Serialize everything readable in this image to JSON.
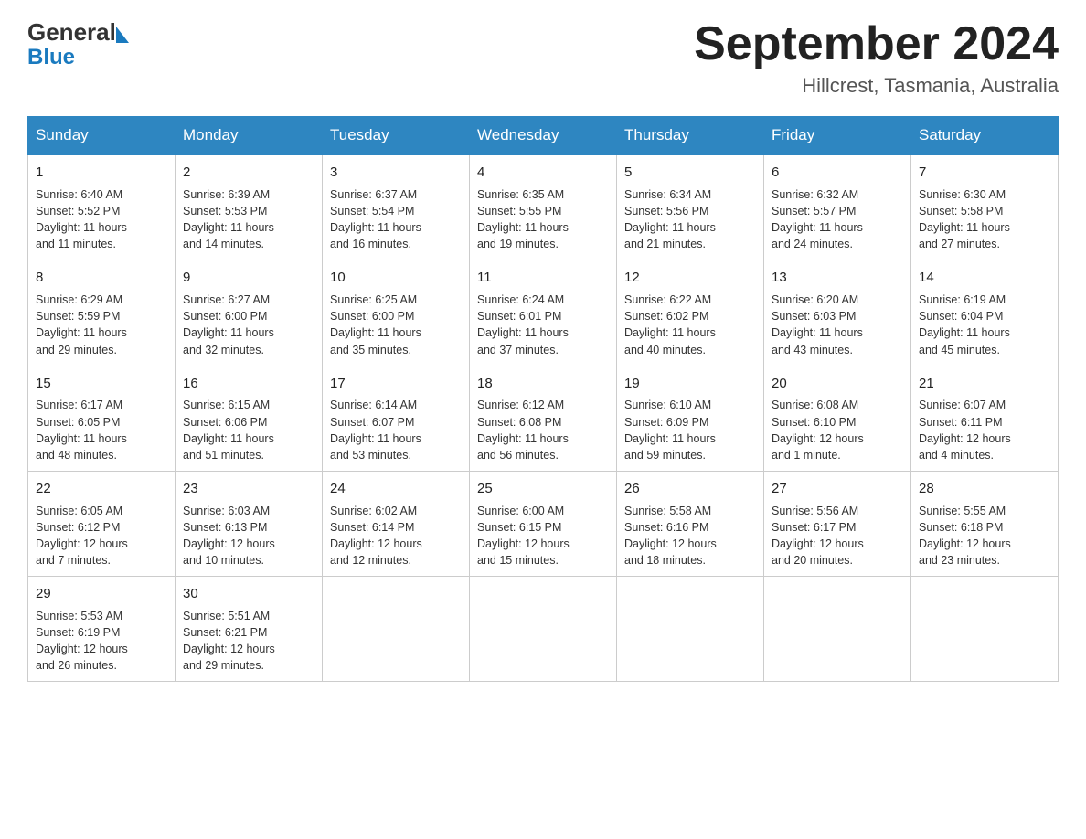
{
  "header": {
    "logo_general": "General",
    "logo_blue": "Blue",
    "month_title": "September 2024",
    "location": "Hillcrest, Tasmania, Australia"
  },
  "days_of_week": [
    "Sunday",
    "Monday",
    "Tuesday",
    "Wednesday",
    "Thursday",
    "Friday",
    "Saturday"
  ],
  "weeks": [
    [
      {
        "day": "1",
        "info": "Sunrise: 6:40 AM\nSunset: 5:52 PM\nDaylight: 11 hours\nand 11 minutes."
      },
      {
        "day": "2",
        "info": "Sunrise: 6:39 AM\nSunset: 5:53 PM\nDaylight: 11 hours\nand 14 minutes."
      },
      {
        "day": "3",
        "info": "Sunrise: 6:37 AM\nSunset: 5:54 PM\nDaylight: 11 hours\nand 16 minutes."
      },
      {
        "day": "4",
        "info": "Sunrise: 6:35 AM\nSunset: 5:55 PM\nDaylight: 11 hours\nand 19 minutes."
      },
      {
        "day": "5",
        "info": "Sunrise: 6:34 AM\nSunset: 5:56 PM\nDaylight: 11 hours\nand 21 minutes."
      },
      {
        "day": "6",
        "info": "Sunrise: 6:32 AM\nSunset: 5:57 PM\nDaylight: 11 hours\nand 24 minutes."
      },
      {
        "day": "7",
        "info": "Sunrise: 6:30 AM\nSunset: 5:58 PM\nDaylight: 11 hours\nand 27 minutes."
      }
    ],
    [
      {
        "day": "8",
        "info": "Sunrise: 6:29 AM\nSunset: 5:59 PM\nDaylight: 11 hours\nand 29 minutes."
      },
      {
        "day": "9",
        "info": "Sunrise: 6:27 AM\nSunset: 6:00 PM\nDaylight: 11 hours\nand 32 minutes."
      },
      {
        "day": "10",
        "info": "Sunrise: 6:25 AM\nSunset: 6:00 PM\nDaylight: 11 hours\nand 35 minutes."
      },
      {
        "day": "11",
        "info": "Sunrise: 6:24 AM\nSunset: 6:01 PM\nDaylight: 11 hours\nand 37 minutes."
      },
      {
        "day": "12",
        "info": "Sunrise: 6:22 AM\nSunset: 6:02 PM\nDaylight: 11 hours\nand 40 minutes."
      },
      {
        "day": "13",
        "info": "Sunrise: 6:20 AM\nSunset: 6:03 PM\nDaylight: 11 hours\nand 43 minutes."
      },
      {
        "day": "14",
        "info": "Sunrise: 6:19 AM\nSunset: 6:04 PM\nDaylight: 11 hours\nand 45 minutes."
      }
    ],
    [
      {
        "day": "15",
        "info": "Sunrise: 6:17 AM\nSunset: 6:05 PM\nDaylight: 11 hours\nand 48 minutes."
      },
      {
        "day": "16",
        "info": "Sunrise: 6:15 AM\nSunset: 6:06 PM\nDaylight: 11 hours\nand 51 minutes."
      },
      {
        "day": "17",
        "info": "Sunrise: 6:14 AM\nSunset: 6:07 PM\nDaylight: 11 hours\nand 53 minutes."
      },
      {
        "day": "18",
        "info": "Sunrise: 6:12 AM\nSunset: 6:08 PM\nDaylight: 11 hours\nand 56 minutes."
      },
      {
        "day": "19",
        "info": "Sunrise: 6:10 AM\nSunset: 6:09 PM\nDaylight: 11 hours\nand 59 minutes."
      },
      {
        "day": "20",
        "info": "Sunrise: 6:08 AM\nSunset: 6:10 PM\nDaylight: 12 hours\nand 1 minute."
      },
      {
        "day": "21",
        "info": "Sunrise: 6:07 AM\nSunset: 6:11 PM\nDaylight: 12 hours\nand 4 minutes."
      }
    ],
    [
      {
        "day": "22",
        "info": "Sunrise: 6:05 AM\nSunset: 6:12 PM\nDaylight: 12 hours\nand 7 minutes."
      },
      {
        "day": "23",
        "info": "Sunrise: 6:03 AM\nSunset: 6:13 PM\nDaylight: 12 hours\nand 10 minutes."
      },
      {
        "day": "24",
        "info": "Sunrise: 6:02 AM\nSunset: 6:14 PM\nDaylight: 12 hours\nand 12 minutes."
      },
      {
        "day": "25",
        "info": "Sunrise: 6:00 AM\nSunset: 6:15 PM\nDaylight: 12 hours\nand 15 minutes."
      },
      {
        "day": "26",
        "info": "Sunrise: 5:58 AM\nSunset: 6:16 PM\nDaylight: 12 hours\nand 18 minutes."
      },
      {
        "day": "27",
        "info": "Sunrise: 5:56 AM\nSunset: 6:17 PM\nDaylight: 12 hours\nand 20 minutes."
      },
      {
        "day": "28",
        "info": "Sunrise: 5:55 AM\nSunset: 6:18 PM\nDaylight: 12 hours\nand 23 minutes."
      }
    ],
    [
      {
        "day": "29",
        "info": "Sunrise: 5:53 AM\nSunset: 6:19 PM\nDaylight: 12 hours\nand 26 minutes."
      },
      {
        "day": "30",
        "info": "Sunrise: 5:51 AM\nSunset: 6:21 PM\nDaylight: 12 hours\nand 29 minutes."
      },
      {
        "day": "",
        "info": ""
      },
      {
        "day": "",
        "info": ""
      },
      {
        "day": "",
        "info": ""
      },
      {
        "day": "",
        "info": ""
      },
      {
        "day": "",
        "info": ""
      }
    ]
  ]
}
